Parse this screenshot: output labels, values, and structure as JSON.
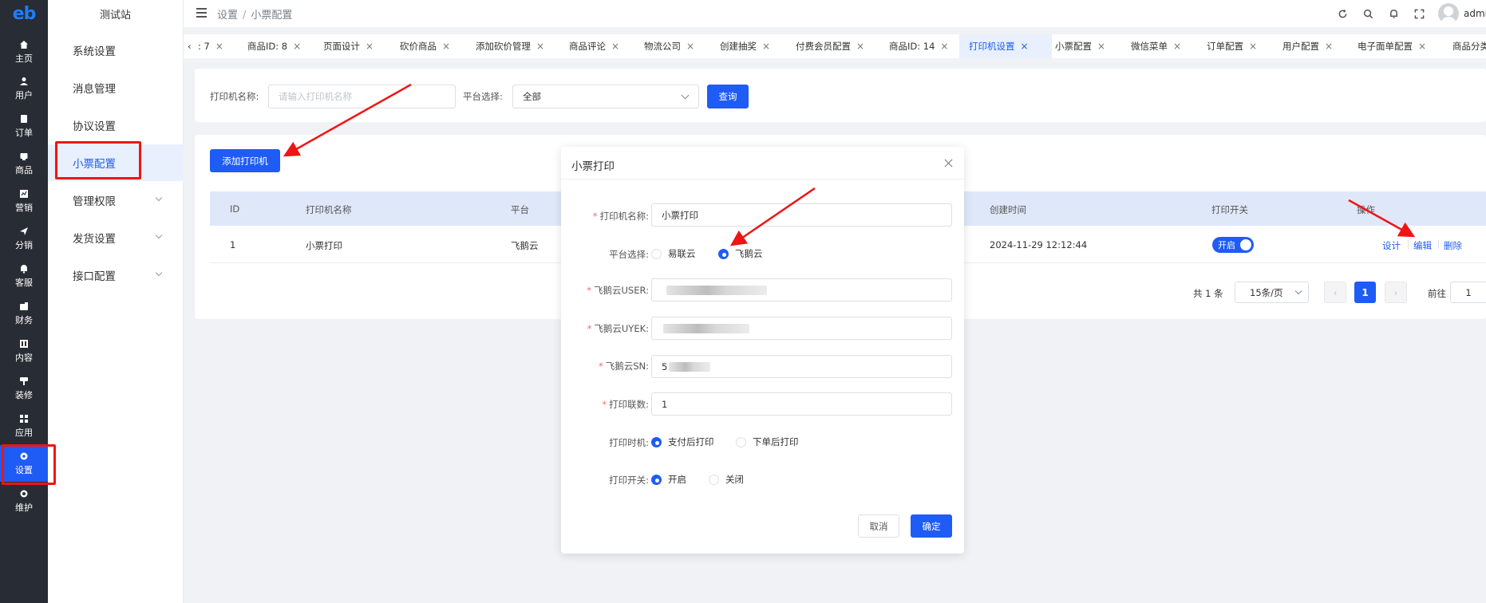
{
  "nav": {
    "logo": "eb",
    "items": [
      {
        "label": "主页",
        "icon": "home-icon"
      },
      {
        "label": "用户",
        "icon": "user-icon"
      },
      {
        "label": "订单",
        "icon": "order-icon"
      },
      {
        "label": "商品",
        "icon": "goods-icon"
      },
      {
        "label": "营销",
        "icon": "marketing-icon"
      },
      {
        "label": "分销",
        "icon": "distribution-icon"
      },
      {
        "label": "客服",
        "icon": "service-icon"
      },
      {
        "label": "财务",
        "icon": "finance-icon"
      },
      {
        "label": "内容",
        "icon": "content-icon"
      },
      {
        "label": "装修",
        "icon": "decorate-icon"
      },
      {
        "label": "应用",
        "icon": "apps-icon"
      },
      {
        "label": "设置",
        "icon": "settings-icon"
      },
      {
        "label": "维护",
        "icon": "maintain-icon"
      }
    ],
    "active": "设置"
  },
  "submenu": {
    "site": "测试站",
    "items": [
      {
        "label": "系统设置"
      },
      {
        "label": "消息管理"
      },
      {
        "label": "协议设置"
      },
      {
        "label": "小票配置"
      },
      {
        "label": "管理权限"
      },
      {
        "label": "发货设置"
      },
      {
        "label": "接口配置"
      }
    ],
    "active": "小票配置"
  },
  "header": {
    "crumb_root": "设置",
    "crumb_sep": "/",
    "crumb_current": "小票配置",
    "admin": "admin",
    "icons": [
      "refresh-icon",
      "search-icon",
      "bell-icon",
      "fullscreen-icon"
    ]
  },
  "tabs": {
    "scroll_left": "‹",
    "items": [
      {
        "label": ": 7"
      },
      {
        "label": "商品ID: 8"
      },
      {
        "label": "页面设计"
      },
      {
        "label": "砍价商品"
      },
      {
        "label": "添加砍价管理"
      },
      {
        "label": "商品评论"
      },
      {
        "label": "物流公司"
      },
      {
        "label": "创建抽奖"
      },
      {
        "label": "付费会员配置"
      },
      {
        "label": "商品ID: 14"
      },
      {
        "label": "打印机设置"
      },
      {
        "label": "小票配置"
      },
      {
        "label": "微信菜单"
      },
      {
        "label": "订单配置"
      },
      {
        "label": "用户配置"
      },
      {
        "label": "电子面单配置"
      },
      {
        "label": "商品分类"
      }
    ],
    "active": "打印机设置",
    "close": "×"
  },
  "search": {
    "name_label": "打印机名称:",
    "name_placeholder": "请输入打印机名称",
    "platform_label": "平台选择:",
    "platform_value": "全部",
    "query_button": "查询"
  },
  "toolbar": {
    "add_button": "添加打印机"
  },
  "table": {
    "columns": {
      "id": "ID",
      "name": "打印机名称",
      "platform": "平台",
      "created": "创建时间",
      "switch": "打印开关",
      "ops": "操作"
    },
    "rows": [
      {
        "id": "1",
        "name": "小票打印",
        "platform": "飞鹅云",
        "created": "2024-11-29 12:12:44",
        "switch": "开启",
        "ops": [
          "设计",
          "编辑",
          "删除"
        ]
      }
    ]
  },
  "pagination": {
    "total": "共 1 条",
    "page_size": "15条/页",
    "prev": "‹",
    "current": "1",
    "next": "›",
    "goto_label": "前往",
    "goto_value": "1"
  },
  "modal": {
    "title": "小票打印",
    "fields": {
      "name_label": "打印机名称:",
      "name_value": "小票打印",
      "platform_label": "平台选择:",
      "platform_options": [
        "易联云",
        "飞鹅云"
      ],
      "platform_selected": "飞鹅云",
      "user_label": "飞鹅云USER:",
      "ukey_label": "飞鹅云UYEK:",
      "sn_label": "飞鹅云SN:",
      "sn_prefix": "5",
      "copies_label": "打印联数:",
      "copies_value": "1",
      "time_label": "打印时机:",
      "time_options": [
        "支付后打印",
        "下单后打印"
      ],
      "time_selected": "支付后打印",
      "switch_label": "打印开关:",
      "switch_options": [
        "开启",
        "关闭"
      ],
      "switch_selected": "开启"
    },
    "cancel": "取消",
    "confirm": "确定"
  },
  "colors": {
    "primary": "#1f5cf5",
    "nav_bg": "#282c34",
    "annotation_red": "#f01414"
  }
}
